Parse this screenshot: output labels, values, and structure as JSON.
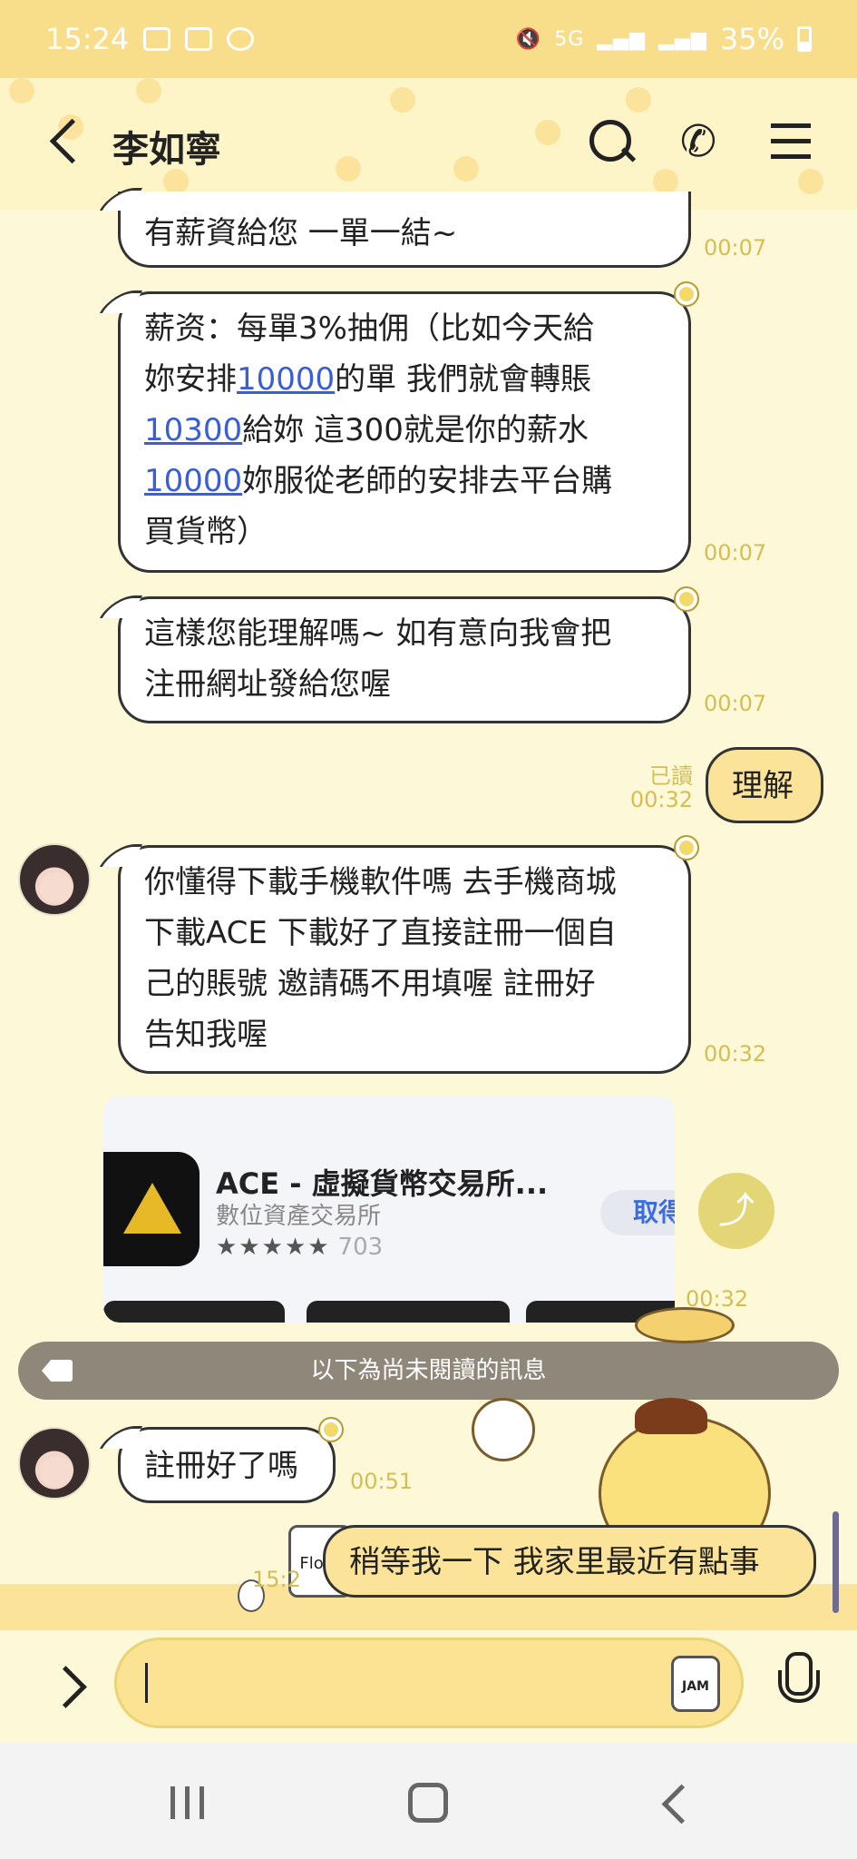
{
  "status_bar": {
    "time": "15:24",
    "network": "5G",
    "battery": "35%"
  },
  "header": {
    "contact_name": "李如寧"
  },
  "messages": {
    "m1": {
      "text": "有薪資給您 一單一結~",
      "time": "00:07"
    },
    "m2": {
      "line1": "薪资：每單3%抽佣（比如今天給",
      "line2_a": "妳安排",
      "line2_link": "10000",
      "line2_b": "的單 我們就會轉賬",
      "line3_link": "10300",
      "line3_b": "給妳  這300就是你的薪水",
      "line4_link": "10000",
      "line4_b": "妳服從老師的安排去平台購",
      "line5": "買貨幣）",
      "time": "00:07"
    },
    "m3": {
      "line1": "這樣您能理解嗎~ 如有意向我會把",
      "line2": "注冊網址發給您喔",
      "time": "00:07"
    },
    "m4": {
      "text": "理解",
      "read_label": "已讀",
      "time": "00:32"
    },
    "m5": {
      "line1": "你懂得下載手機軟件嗎 去手機商城",
      "line2": "下載ACE 下載好了直接註冊一個自",
      "line3": "己的賬號 邀請碼不用填喔 註冊好",
      "line4": "告知我喔",
      "time": "00:32"
    },
    "m6": {
      "app_name": "ACE - 虛擬貨幣交易所...",
      "app_developer": "數位資產交易所",
      "app_stars": "★★★★★",
      "app_rating_count": "703",
      "app_button": "取得",
      "time": "00:32"
    },
    "m7": {
      "text": "註冊好了嗎",
      "time": "00:51"
    },
    "m8": {
      "text": "稍等我一下 我家里最近有點事",
      "time": "15:2"
    }
  },
  "unread_divider": {
    "text": "以下為尚未閱讀的訊息"
  },
  "input": {
    "placeholder": "",
    "jam_label": "JAM",
    "flour_label": "Flour"
  },
  "colors": {
    "accent": "#fbe393",
    "status_bar": "#f8de8a",
    "link": "#3a5ed8",
    "time_text": "#d5bd55"
  }
}
